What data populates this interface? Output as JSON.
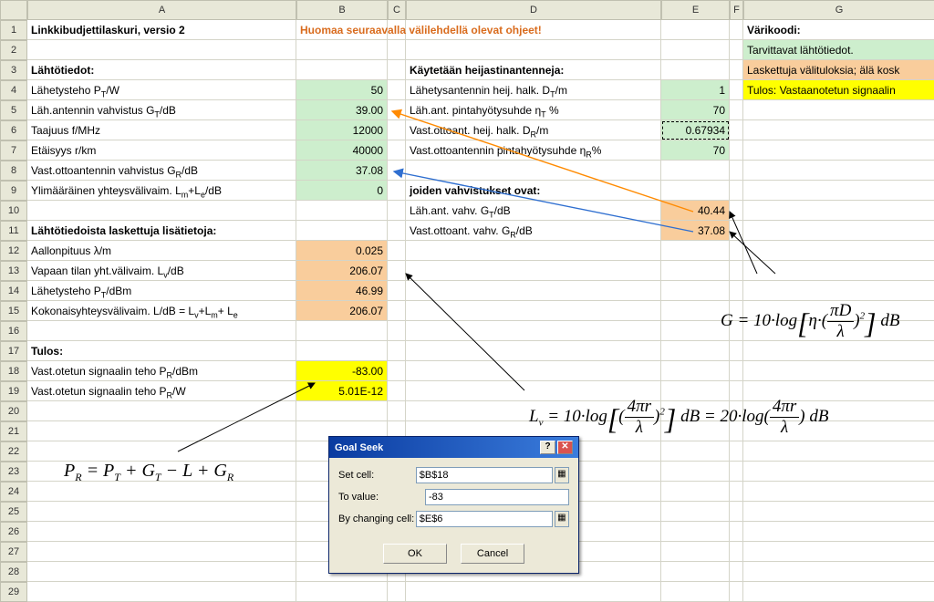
{
  "columns": [
    "",
    "A",
    "B",
    "C",
    "D",
    "E",
    "F",
    "G"
  ],
  "rows": [
    {
      "n": 1,
      "A": "Linkkibudjettilaskuri, versio 2",
      "B": "Huomaa seuraavalla välilehdellä olevat ohjeet!",
      "G": "Värikoodi:"
    },
    {
      "n": 2,
      "G": "Tarvittavat lähtötiedot."
    },
    {
      "n": 3,
      "A": "Lähtötiedot:",
      "D": "Käytetään heijastinantenneja:",
      "G": "Laskettuja välituloksia; älä kosk"
    },
    {
      "n": 4,
      "A": "Lähetysteho P_T/W",
      "B": "50",
      "D": "Lähetysantennin heij. halk. D_T/m",
      "E": "1",
      "G": "Tulos: Vastaanotetun signaalin"
    },
    {
      "n": 5,
      "A": "Läh.antennin vahvistus G_T/dB",
      "B": "39.00",
      "D": "Läh.ant. pintahyötysuhde η_T %",
      "E": "70"
    },
    {
      "n": 6,
      "A": "Taajuus f/MHz",
      "B": "12000",
      "D": "Vast.ottoant. heij. halk. D_R/m",
      "E": "0.67934"
    },
    {
      "n": 7,
      "A": "Etäisyys r/km",
      "B": "40000",
      "D": "Vast.ottoantennin pintahyötysuhde η_R%",
      "E": "70"
    },
    {
      "n": 8,
      "A": "Vast.ottoantennin vahvistus G_R/dB",
      "B": "37.08"
    },
    {
      "n": 9,
      "A": "Ylimääräinen yhteysvälivaim. L_m+L_e/dB",
      "B": "0",
      "D": "joiden vahvistukset ovat:"
    },
    {
      "n": 10,
      "D": "Läh.ant. vahv. G_T/dB",
      "E": "40.44"
    },
    {
      "n": 11,
      "A": "Lähtötiedoista laskettuja lisätietoja:",
      "D": "Vast.ottoant. vahv. G_R/dB",
      "E": "37.08"
    },
    {
      "n": 12,
      "A": "Aallonpituus λ/m",
      "B": "0.025"
    },
    {
      "n": 13,
      "A": "Vapaan tilan yht.välivaim. L_v/dB",
      "B": "206.07"
    },
    {
      "n": 14,
      "A": "Lähetysteho P_T/dBm",
      "B": "46.99"
    },
    {
      "n": 15,
      "A": "Kokonaisyhteysvälivaim. L/dB = L_v+L_m+ L_e",
      "B": "206.07"
    },
    {
      "n": 16
    },
    {
      "n": 17,
      "A": "Tulos:"
    },
    {
      "n": 18,
      "A": "Vast.otetun signaalin teho P_R/dBm",
      "B": "-83.00"
    },
    {
      "n": 19,
      "A": "Vast.otetun signaalin teho P_R/W",
      "B": "5.01E-12"
    },
    {
      "n": 20
    },
    {
      "n": 21
    },
    {
      "n": 22
    },
    {
      "n": 23
    },
    {
      "n": 24
    },
    {
      "n": 25
    },
    {
      "n": 26
    },
    {
      "n": 27
    },
    {
      "n": 28
    },
    {
      "n": 29
    }
  ],
  "dialog": {
    "title": "Goal Seek",
    "set_cell_label": "Set cell:",
    "set_cell_value": "$B$18",
    "to_value_label": "To value:",
    "to_value_value": "-83",
    "by_changing_label": "By changing cell:",
    "by_changing_value": "$E$6",
    "ok": "OK",
    "cancel": "Cancel"
  },
  "formulas": {
    "pr": "P_R = P_T + G_T − L + G_R",
    "lv": "L_v = 10·log[(4πr/λ)²] dB = 20·log(4πr/λ) dB",
    "g": "G = 10·log[η·(πD/λ)²] dB"
  },
  "colors": {
    "input_bg": "#cdeecd",
    "calc_bg": "#f9cd9c",
    "result_bg": "#ffff00",
    "trace_orange": "#ff8a00",
    "trace_blue": "#2f6fd0"
  }
}
